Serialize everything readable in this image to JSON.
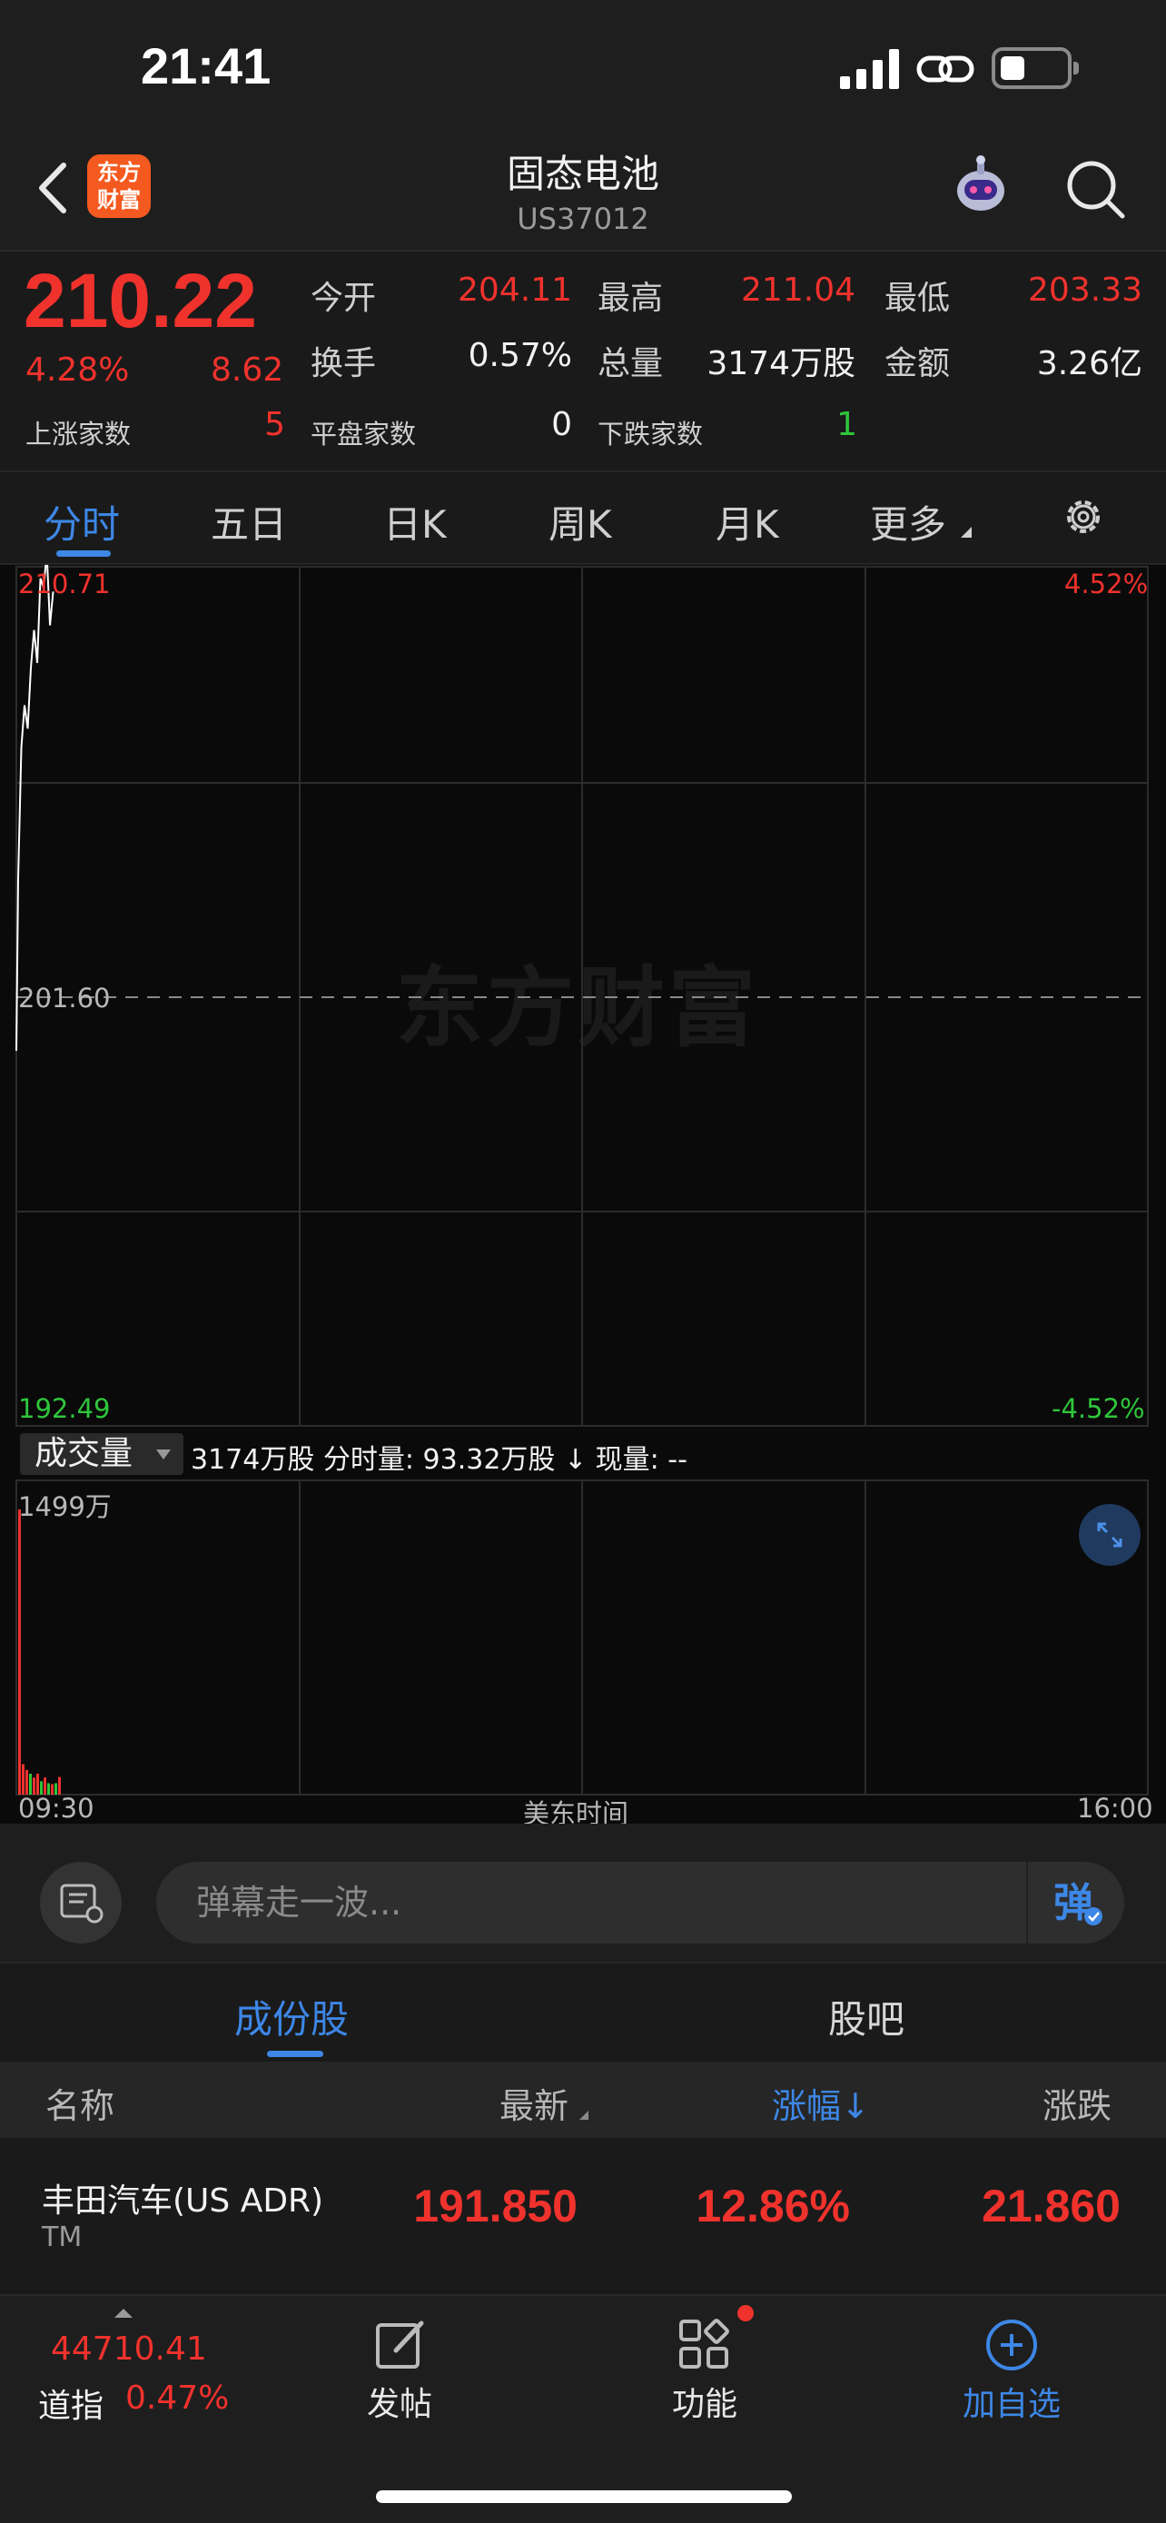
{
  "status_bar": {
    "time": "21:41"
  },
  "header": {
    "app_logo": "东方\n财富",
    "title": "固态电池",
    "subtitle": "US37012"
  },
  "quote": {
    "price": "210.22",
    "change_pct": "4.28%",
    "change_val": "8.62",
    "open_label": "今开",
    "open": "204.11",
    "high_label": "最高",
    "high": "211.04",
    "low_label": "最低",
    "low": "203.33",
    "turnover_label": "换手",
    "turnover": "0.57%",
    "volume_label": "总量",
    "volume": "3174万股",
    "amount_label": "金额",
    "amount": "3.26亿",
    "up_count_label": "上涨家数",
    "up_count": "5",
    "flat_count_label": "平盘家数",
    "flat_count": "0",
    "down_count_label": "下跌家数",
    "down_count": "1"
  },
  "tabs": {
    "items": [
      "分时",
      "五日",
      "日K",
      "周K",
      "月K",
      "更多"
    ],
    "active": "分时"
  },
  "chart": {
    "y_max_label": "210.71",
    "y_mid_label": "201.60",
    "y_min_label": "192.49",
    "pct_max_label": "4.52%",
    "pct_min_label": "-4.52%",
    "watermark": "东方财富",
    "volume_selector": "成交量",
    "volume_info": "3174万股 分时量: 93.32万股 ↓ 现量: --",
    "volume_max_label": "1499万",
    "time_start": "09:30",
    "time_mid": "美东时间",
    "time_end": "16:00"
  },
  "danmu": {
    "placeholder": "弹幕走一波..."
  },
  "sub_tabs": {
    "items": [
      "成份股",
      "股吧"
    ],
    "active": "成份股"
  },
  "table": {
    "headers": [
      "名称",
      "最新",
      "涨幅↓",
      "涨跌"
    ],
    "rows": [
      {
        "name": "丰田汽车(US ADR)",
        "code": "TM",
        "latest": "191.850",
        "pct": "12.86%",
        "change": "21.860"
      }
    ]
  },
  "bottom_nav": {
    "index_value": "44710.41",
    "index_name": "道指",
    "index_pct": "0.47%",
    "items": [
      "发帖",
      "功能",
      "加自选"
    ]
  },
  "colors": {
    "up": "#f0322d",
    "down": "#2fc53b",
    "accent": "#3d87e6"
  },
  "chart_data": {
    "type": "line",
    "title": "",
    "xlabel": "美东时间",
    "ylabel": "",
    "ylim": [
      192.49,
      210.71
    ],
    "prev_close": 201.6,
    "x": [
      "09:30",
      "09:31",
      "09:32",
      "09:33",
      "09:34",
      "09:35",
      "09:36",
      "09:37",
      "09:38",
      "09:39",
      "09:40",
      "09:41"
    ],
    "series": [
      {
        "values": [
          204.11,
          206.9,
          207.8,
          207.3,
          208.6,
          209.4,
          208.7,
          210.5,
          210.3,
          211.04,
          209.5,
          210.22
        ]
      }
    ],
    "volume": {
      "max_label": "1499万",
      "values": [
        1499,
        160,
        130,
        110,
        90,
        110,
        70,
        90,
        60,
        55,
        60,
        93
      ]
    }
  }
}
